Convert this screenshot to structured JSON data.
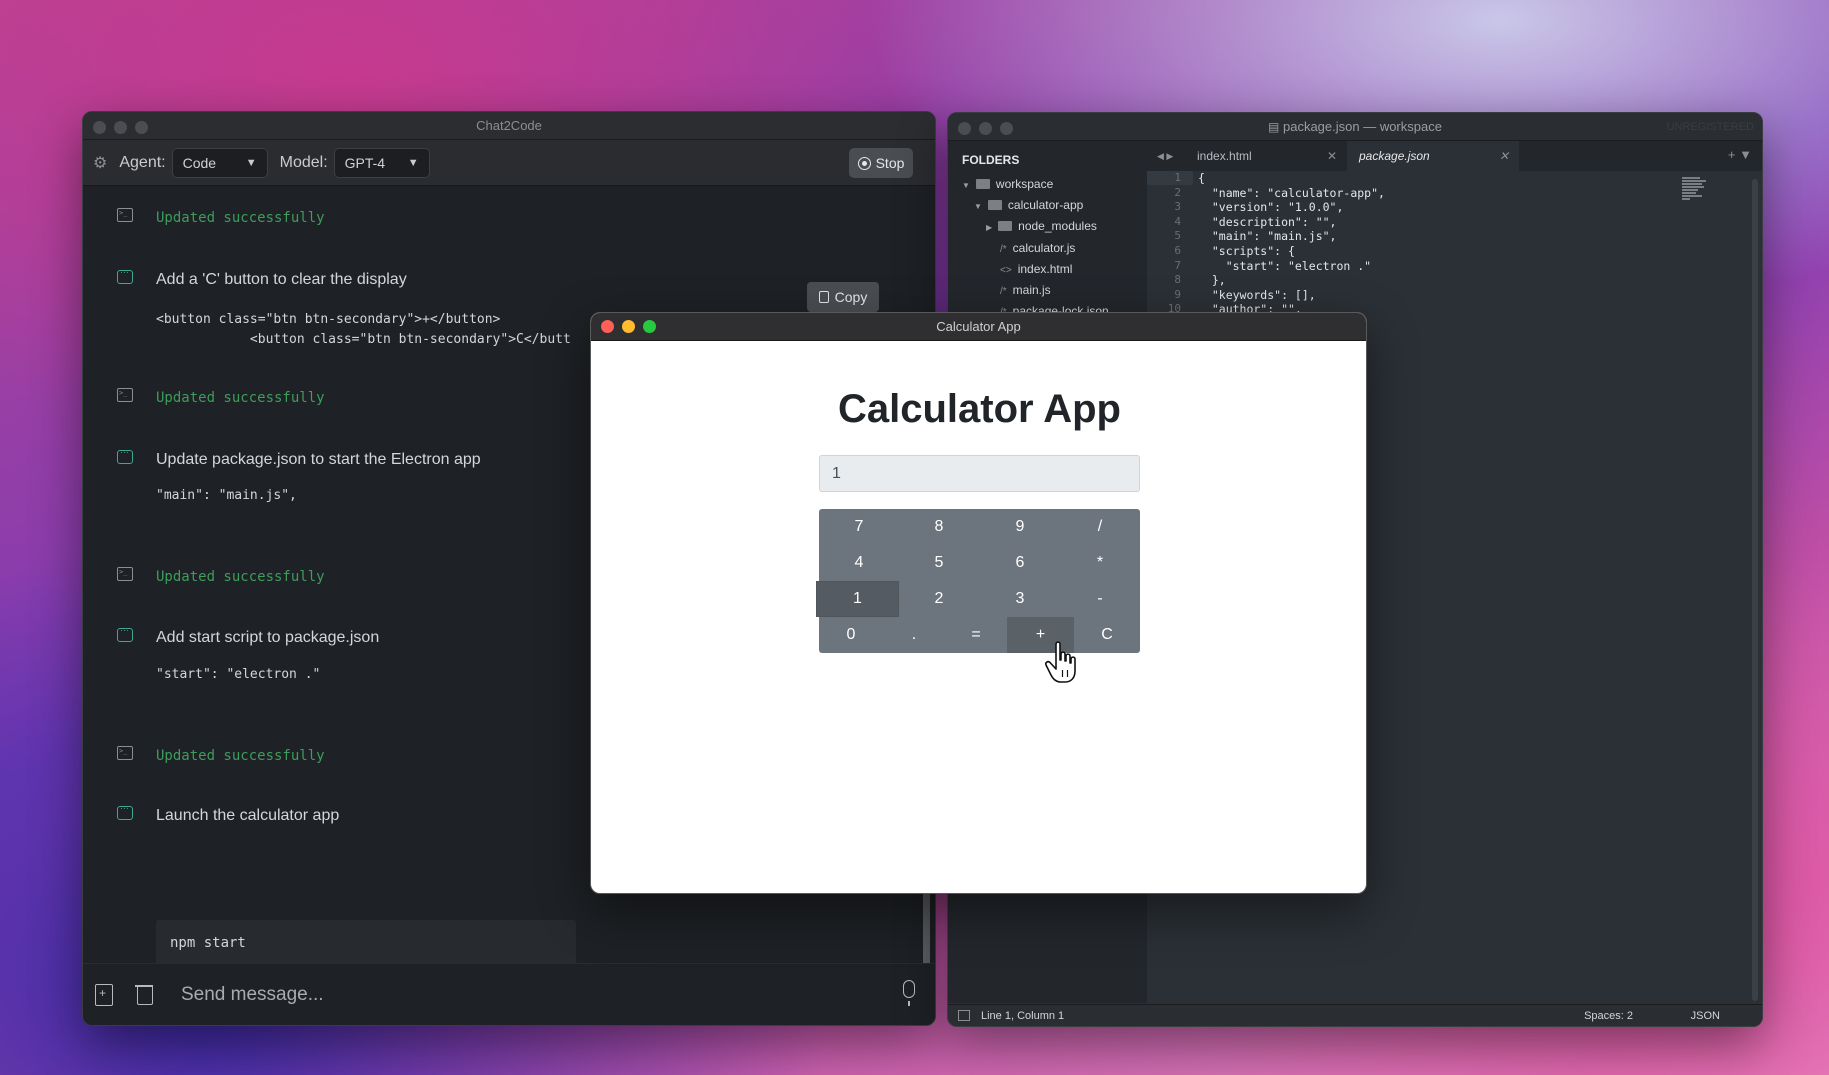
{
  "chat": {
    "window_title": "Chat2Code",
    "agent_label": "Agent:",
    "agent_value": "Code",
    "model_label": "Model:",
    "model_value": "GPT-4",
    "stop_label": "Stop",
    "copy_label": "Copy",
    "messages": [
      {
        "type": "tool",
        "text": "Updated successfully"
      },
      {
        "type": "step",
        "text": "Add a 'C' button to clear the display"
      },
      {
        "type": "code",
        "text": "<button class=\"btn btn-secondary\">+</button>\n            <button class=\"btn btn-secondary\">C</butt"
      },
      {
        "type": "tool",
        "text": "Updated successfully"
      },
      {
        "type": "step",
        "text": "Update package.json to start the Electron app"
      },
      {
        "type": "code",
        "text": "\"main\": \"main.js\","
      },
      {
        "type": "tool",
        "text": "Updated successfully"
      },
      {
        "type": "step",
        "text": "Add start script to package.json"
      },
      {
        "type": "code",
        "text": "\"start\": \"electron .\""
      },
      {
        "type": "tool",
        "text": "Updated successfully"
      },
      {
        "type": "step",
        "text": "Launch the calculator app"
      },
      {
        "type": "code",
        "text": "npm start"
      }
    ],
    "input_placeholder": "Send message..."
  },
  "editor": {
    "window_title": "package.json — workspace",
    "unregistered": "UNREGISTERED",
    "folders_header": "FOLDERS",
    "tree": [
      "workspace",
      "calculator-app",
      "node_modules",
      "calculator.js",
      "index.html",
      "main.js",
      "package-lock.json"
    ],
    "tabs": [
      "index.html",
      "package.json"
    ],
    "line_numbers": [
      "1",
      "2",
      "3",
      "4",
      "5",
      "6",
      "7",
      "8",
      "9",
      "10"
    ],
    "code_lines": [
      "{",
      "  \"name\": \"calculator-app\",",
      "  \"version\": \"1.0.0\",",
      "  \"description\": \"\",",
      "  \"main\": \"main.js\",",
      "  \"scripts\": {",
      "    \"start\": \"electron .\"",
      "  },",
      "  \"keywords\": [],",
      "  \"author\": \"\","
    ],
    "status_position": "Line 1, Column 1",
    "status_spaces": "Spaces: 2",
    "status_language": "JSON"
  },
  "calculator": {
    "window_title": "Calculator App",
    "heading": "Calculator App",
    "display_value": "1",
    "keys": [
      [
        "7",
        "8",
        "9",
        "/"
      ],
      [
        "4",
        "5",
        "6",
        "*"
      ],
      [
        "1",
        "2",
        "3",
        "-"
      ],
      [
        "0",
        ".",
        "=",
        "+",
        "C"
      ]
    ]
  },
  "colors": {
    "accent_green": "#3d9d5a",
    "keypad": "#6c757d",
    "close": "#fe5f57",
    "minimize": "#febc2e",
    "maximize": "#28c840"
  }
}
